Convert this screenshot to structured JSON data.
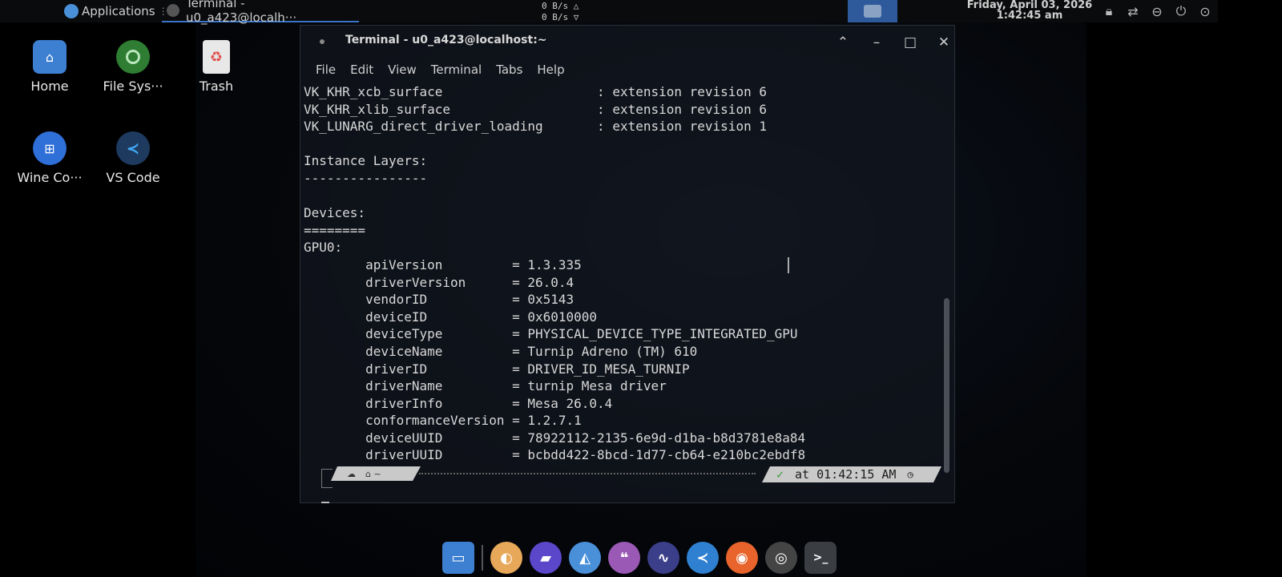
{
  "top_panel": {
    "applications_label": "Applications",
    "task_title": "Terminal - u0_a423@localh···",
    "net_up": "0 B/s △",
    "net_down": "0 B/s ▽",
    "clock_date": "Friday, April 03, 2026",
    "clock_time": "1:42:45 am",
    "tray_icons": [
      "lock-icon",
      "network-icon",
      "do-not-disturb-icon",
      "power-icon",
      "next-icon"
    ]
  },
  "desktop_icons": [
    {
      "label": "Home",
      "icon": "folder-home-icon",
      "color": "#3d7fd1"
    },
    {
      "label": "File Sys···",
      "icon": "filesystem-icon",
      "color": "#4caf50"
    },
    {
      "label": "Trash",
      "icon": "trash-icon",
      "color": "#e0e0e0"
    },
    {
      "label": "Wine Co···",
      "icon": "wine-config-icon",
      "color": "#2f6fd8"
    },
    {
      "label": "VS Code",
      "icon": "vscode-icon",
      "color": "#2f80d0"
    }
  ],
  "terminal": {
    "title": "Terminal - u0_a423@localhost:~",
    "menu": [
      "File",
      "Edit",
      "View",
      "Terminal",
      "Tabs",
      "Help"
    ],
    "lines": [
      "VK_KHR_xcb_surface                    : extension revision 6",
      "VK_KHR_xlib_surface                   : extension revision 6",
      "VK_LUNARG_direct_driver_loading       : extension revision 1",
      "",
      "Instance Layers:",
      "----------------",
      "",
      "Devices:",
      "========",
      "GPU0:",
      "        apiVersion         = 1.3.335",
      "        driverVersion      = 26.0.4",
      "        vendorID           = 0x5143",
      "        deviceID           = 0x6010000",
      "        deviceType         = PHYSICAL_DEVICE_TYPE_INTEGRATED_GPU",
      "        deviceName         = Turnip Adreno (TM) 610",
      "        driverID           = DRIVER_ID_MESA_TURNIP",
      "        driverName         = turnip Mesa driver",
      "        driverInfo         = Mesa 26.0.4",
      "        conformanceVersion = 1.2.7.1",
      "        deviceUUID         = 78922112-2135-6e9d-d1ba-b8d3781e8a84",
      "        driverUUID         = bcbdd422-8bcd-1d77-cb64-e210bc2ebdf8"
    ],
    "prompt_status": "✓",
    "prompt_time": "at 01:42:15 AM"
  },
  "dock": {
    "items": [
      {
        "name": "files-icon",
        "color": "#3d7fd1"
      },
      {
        "name": "app-drawer-icon",
        "color": "#e8a85a"
      },
      {
        "name": "folder-icon",
        "color": "#5a47c9"
      },
      {
        "name": "image-viewer-icon",
        "color": "#4a90d9"
      },
      {
        "name": "notes-icon",
        "color": "#9b59b6"
      },
      {
        "name": "system-monitor-icon",
        "color": "#3b3f8a"
      },
      {
        "name": "vscode-icon",
        "color": "#2f80d0"
      },
      {
        "name": "firefox-icon",
        "color": "#e8642c"
      },
      {
        "name": "chrome-icon",
        "color": "#444444"
      },
      {
        "name": "terminal-icon",
        "color": "#3a3d42"
      }
    ]
  }
}
